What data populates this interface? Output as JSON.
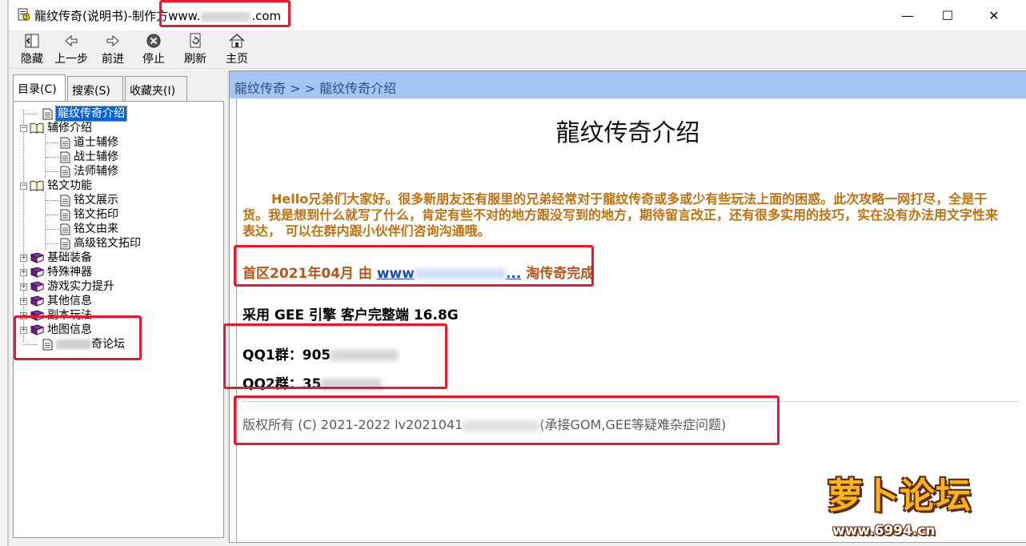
{
  "window": {
    "title_prefix": "龍纹传奇(说明书)-制作方www.",
    "title_suffix": ".com",
    "minimize": "—",
    "maximize": "☐",
    "close": "✕"
  },
  "toolbar": {
    "hide": "隐藏",
    "back": "上一步",
    "forward": "前进",
    "stop": "停止",
    "refresh": "刷新",
    "home": "主页"
  },
  "tabs": {
    "contents": "目录(C)",
    "search": "搜索(S)",
    "favorites": "收藏夹(I)"
  },
  "tree": {
    "intro": "龍纹传奇介绍",
    "assist": "辅修介绍",
    "assist_taoist": "道士辅修",
    "assist_warrior": "战士辅修",
    "assist_mage": "法师辅修",
    "inscription": "铭文功能",
    "insc_show": "铭文展示",
    "insc_rubbing": "铭文拓印",
    "insc_origin": "铭文由来",
    "insc_advanced": "高级铭文拓印",
    "basic_gear": "基础装备",
    "special_artifact": "特殊神器",
    "power_up": "游戏实力提升",
    "other_info": "其他信息",
    "dungeon": "副本玩法",
    "map_info": "地图信息",
    "forum_suffix": "奇论坛"
  },
  "content": {
    "breadcrumb": "龍纹传奇 > > 龍纹传奇介绍",
    "heading": "龍纹传奇介绍",
    "intro": "Hello兄弟们大家好。很多新朋友还有服里的兄弟经常对于龍纹传奇或多或少有些玩法上面的困惑。此次攻略一网打尽，全是干货。我是想到什么就写了什么，肯定有些不对的地方跟没写到的地方，期待留言改正，还有很多实用的技巧，实在没有办法用文字性来表达， 可以在群内跟小伙伴们咨询沟通哦。",
    "region_prefix": "首区2021年04月 由 ",
    "region_link": "www",
    "region_link_end": "...",
    "region_suffix": " 淘传奇完成",
    "engine": "采用 GEE 引擎  客户完整端 16.8G",
    "qq1_label": "QQ1群：",
    "qq1_visible": "905",
    "qq2_label": "QQ2群：",
    "qq2_visible": "35",
    "copyright_prefix": "版权所有 (C) 2021-2022 lv2021041",
    "copyright_suffix": "(承接GOM,GEE等疑难杂症问题)"
  },
  "watermark": {
    "logo_text": "萝卜论坛",
    "url": "www.6994.cn"
  },
  "colors": {
    "highlight_box": "#e8192c",
    "breadcrumb_bg": "#a3c6f4",
    "intro_text": "#c0710f",
    "tree_selection": "#0a64d8"
  }
}
